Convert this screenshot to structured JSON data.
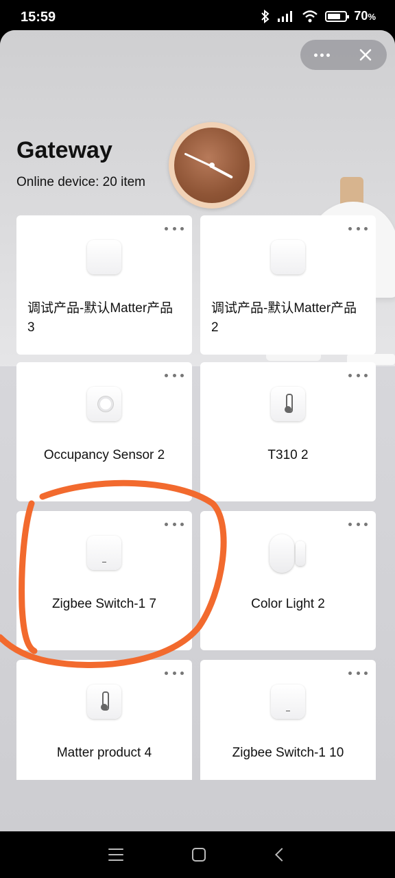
{
  "status_bar": {
    "time": "15:59",
    "battery": "70",
    "battery_unit": "%"
  },
  "header": {
    "title": "Gateway",
    "subtitle": "Online device: 20 item"
  },
  "devices": [
    {
      "label": "调试产品-默认Matter产品 3",
      "icon": "smart-panel-icon"
    },
    {
      "label": "调试产品-默认Matter产品 2",
      "icon": "smart-panel-icon"
    },
    {
      "label": "Occupancy Sensor 2",
      "icon": "occupancy-sensor-icon"
    },
    {
      "label": "T310 2",
      "icon": "thermometer-icon"
    },
    {
      "label": "Zigbee Switch-1 7",
      "icon": "switch-icon"
    },
    {
      "label": "Color Light 2",
      "icon": "door-sensor-icon"
    },
    {
      "label": "Matter product 4",
      "icon": "thermometer-icon"
    },
    {
      "label": "Zigbee Switch-1 10",
      "icon": "switch-icon"
    }
  ],
  "colors": {
    "annotation_stroke": "#f26a2e",
    "card_background": "#ffffff"
  }
}
